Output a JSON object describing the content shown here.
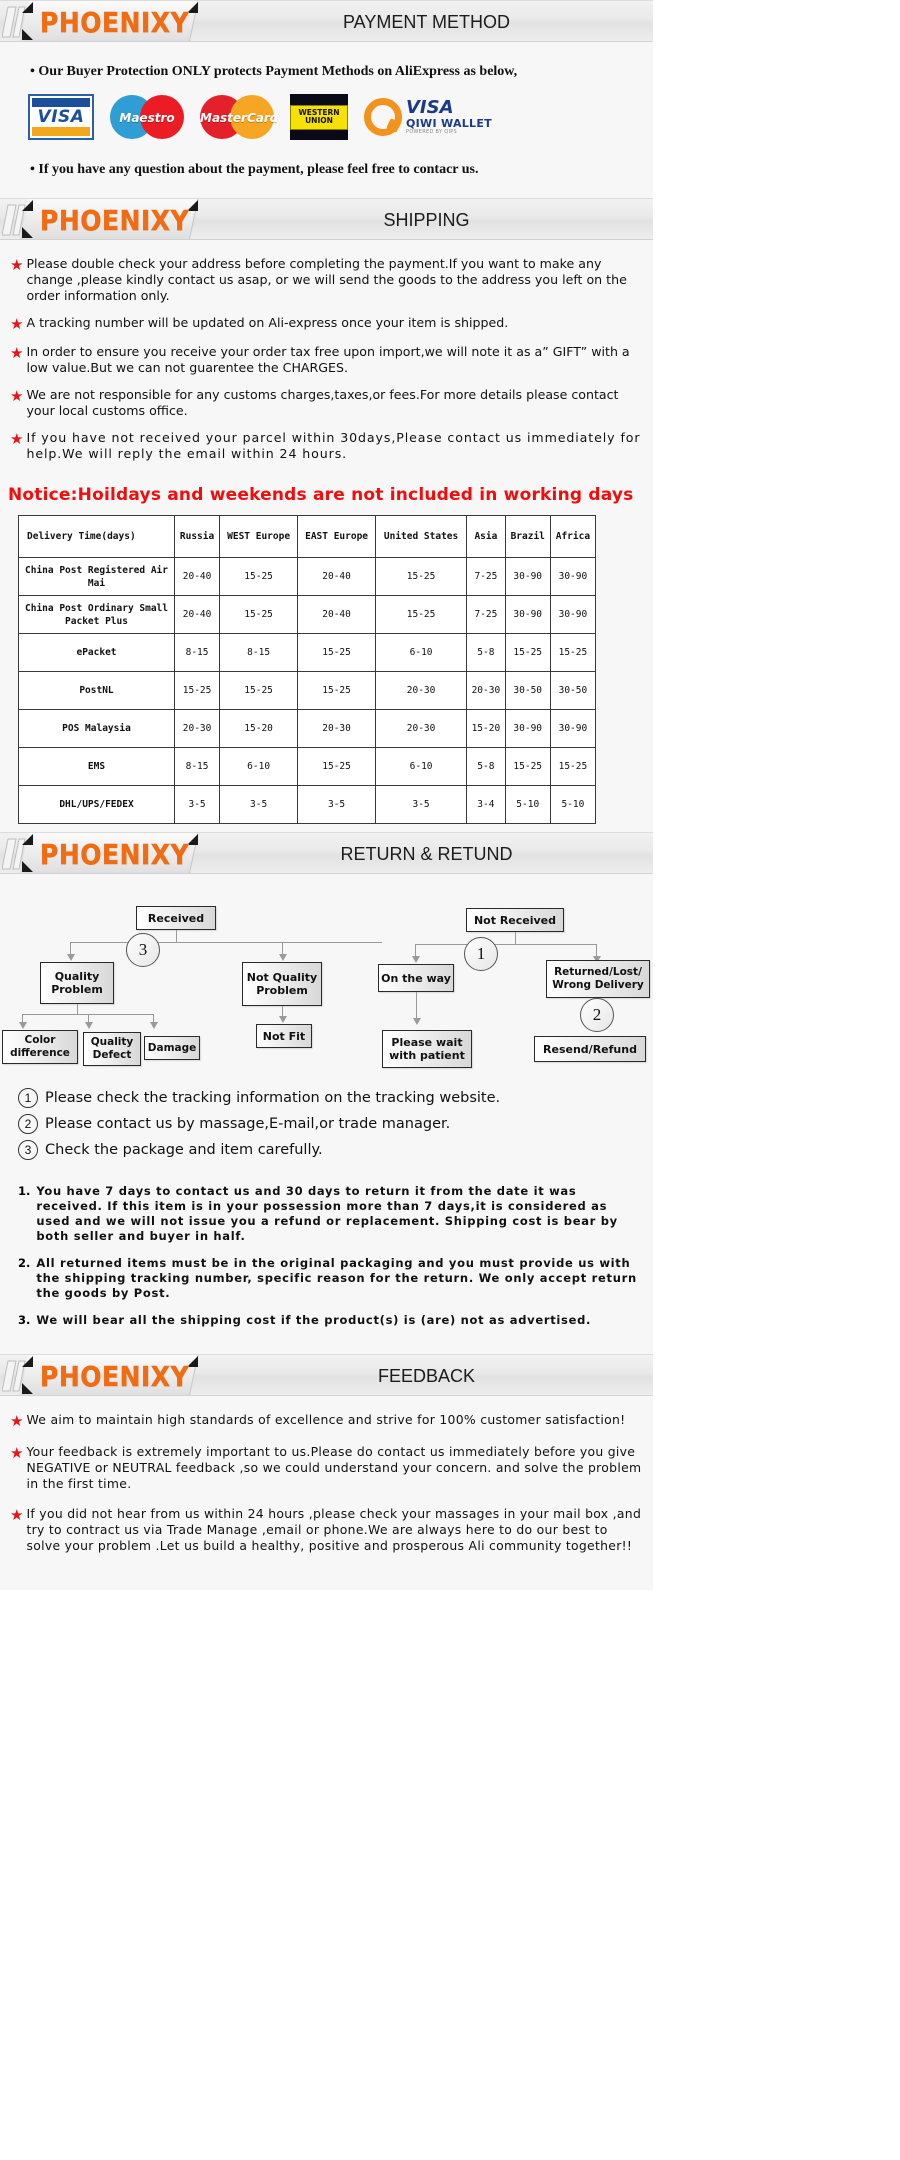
{
  "brand": {
    "logo_text": "PHOENIXY",
    "accent_color": "#ef6c14"
  },
  "sections": {
    "payment": {
      "title": "PAYMENT METHOD",
      "line_top": "• Our Buyer Protection ONLY protects Payment Methods on AliExpress as below,",
      "line_bottom": "• If you have any question about the payment, please feel free to contacr us.",
      "logos": [
        {
          "name": "visa-logo",
          "label": "VISA"
        },
        {
          "name": "maestro-logo",
          "label": "Maestro"
        },
        {
          "name": "mastercard-logo",
          "label": "MasterCard"
        },
        {
          "name": "western-union-logo",
          "label": "WESTERN UNION"
        },
        {
          "name": "qiwi-wallet-logo",
          "label": "VISA",
          "sub": "QIWI WALLET",
          "powered": "POWERED BY QIPS"
        }
      ]
    },
    "shipping": {
      "title": "SHIPPING",
      "bullets": [
        "Please double check your address before completing the payment.If you want to make any change ,please kindly contact us asap, or we will send the goods to the address you left on the order information only.",
        "A tracking number will be updated on Ali-express once your item is shipped.",
        "In order to ensure you receive your order tax free upon import,we will note it as a” GIFT” with a low value.But we can not guarentee the CHARGES.",
        "We are not responsible for any customs charges,taxes,or fees.For more details please contact your local customs office.",
        "If you have not received your parcel within 30days,Please contact us immediately for help.We will reply the email within 24 hours."
      ],
      "notice": "Notice:Hoildays and weekends are not included in working days",
      "table": {
        "headers": [
          "Delivery Time(days)",
          "Russia",
          "WEST Europe",
          "EAST Europe",
          "United States",
          "Asia",
          "Brazil",
          "Africa"
        ],
        "rows": [
          {
            "method": "China Post Registered Air Mai",
            "values": [
              "20-40",
              "15-25",
              "20-40",
              "15-25",
              "7-25",
              "30-90",
              "30-90"
            ]
          },
          {
            "method": "China Post Ordinary Small Packet Plus",
            "values": [
              "20-40",
              "15-25",
              "20-40",
              "15-25",
              "7-25",
              "30-90",
              "30-90"
            ]
          },
          {
            "method": "ePacket",
            "values": [
              "8-15",
              "8-15",
              "15-25",
              "6-10",
              "5-8",
              "15-25",
              "15-25"
            ]
          },
          {
            "method": "PostNL",
            "values": [
              "15-25",
              "15-25",
              "15-25",
              "20-30",
              "20-30",
              "30-50",
              "30-50"
            ]
          },
          {
            "method": "POS Malaysia",
            "values": [
              "20-30",
              "15-20",
              "20-30",
              "20-30",
              "15-20",
              "30-90",
              "30-90"
            ]
          },
          {
            "method": "EMS",
            "values": [
              "8-15",
              "6-10",
              "15-25",
              "6-10",
              "5-8",
              "15-25",
              "15-25"
            ]
          },
          {
            "method": "DHL/UPS/FEDEX",
            "values": [
              "3-5",
              "3-5",
              "3-5",
              "3-5",
              "3-4",
              "5-10",
              "5-10"
            ]
          }
        ]
      }
    },
    "returns": {
      "title": "RETURN & RETUND",
      "flow": {
        "received": "Received",
        "badge_3": "3",
        "quality_problem": "Quality Problem",
        "not_quality_problem": "Not Quality Problem",
        "color_difference": "Color difference",
        "quality_defect": "Quality Defect",
        "damage": "Damage",
        "not_fit": "Not Fit",
        "not_received": "Not  Received",
        "badge_1": "1",
        "badge_2": "2",
        "on_the_way": "On the way",
        "returned_lost": "Returned/Lost/ Wrong Delivery",
        "please_wait": "Please wait with patient",
        "resend_refund": "Resend/Refund"
      },
      "notes": [
        {
          "num": "1",
          "text": "Please check the tracking information on the tracking website."
        },
        {
          "num": "2",
          "text": "Please contact us by  massage,E-mail,or trade manager."
        },
        {
          "num": "3",
          "text": "Check the package and item carefully."
        }
      ],
      "policy": [
        {
          "num": "1.",
          "text": "You have 7 days to contact us and 30 days to return it from the date it was received. If this item is in your possession more than 7 days,it is considered as used and we will not issue you a refund or replacement. Shipping cost is bear by both seller and buyer in half."
        },
        {
          "num": "2.",
          "text": "All returned items must be in the original packaging and you must provide us with the shipping tracking number, specific reason for the return. We only accept return the goods by Post."
        },
        {
          "num": "3.",
          "text": "We will bear all the shipping cost if the product(s) is (are) not as advertised."
        }
      ]
    },
    "feedback": {
      "title": "FEEDBACK",
      "items": [
        "We aim to maintain high standards of excellence and strive  for 100% customer satisfaction!",
        "Your feedback is extremely important to us.Please do contact us immediately before you give NEGATIVE or NEUTRAL feedback ,so  we could understand your concern. and solve the problem in the first time.",
        "If you did not hear from us within 24 hours ,please check your massages in your mail box ,and try to contract us via Trade Manage ,email or phone.We are always here to do our best to solve your problem .Let us build a healthy, positive and prosperous Ali community together!!"
      ]
    }
  }
}
